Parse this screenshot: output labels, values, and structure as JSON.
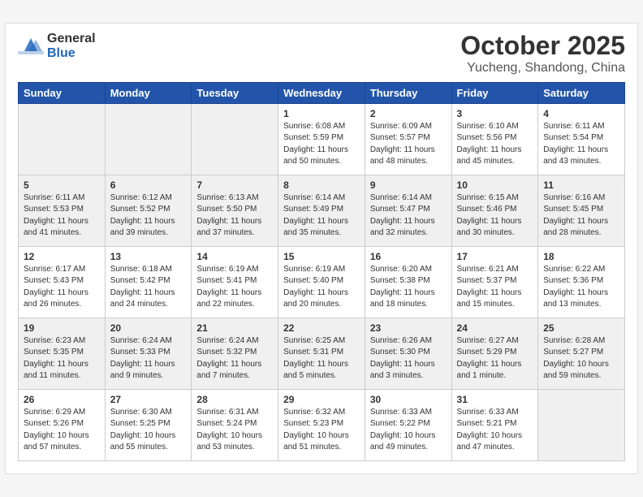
{
  "header": {
    "logo_general": "General",
    "logo_blue": "Blue",
    "month_title": "October 2025",
    "location": "Yucheng, Shandong, China"
  },
  "weekdays": [
    "Sunday",
    "Monday",
    "Tuesday",
    "Wednesday",
    "Thursday",
    "Friday",
    "Saturday"
  ],
  "weeks": [
    [
      {
        "day": "",
        "sunrise": "",
        "sunset": "",
        "daylight": "",
        "empty": true
      },
      {
        "day": "",
        "sunrise": "",
        "sunset": "",
        "daylight": "",
        "empty": true
      },
      {
        "day": "",
        "sunrise": "",
        "sunset": "",
        "daylight": "",
        "empty": true
      },
      {
        "day": "1",
        "sunrise": "Sunrise: 6:08 AM",
        "sunset": "Sunset: 5:59 PM",
        "daylight": "Daylight: 11 hours and 50 minutes.",
        "empty": false
      },
      {
        "day": "2",
        "sunrise": "Sunrise: 6:09 AM",
        "sunset": "Sunset: 5:57 PM",
        "daylight": "Daylight: 11 hours and 48 minutes.",
        "empty": false
      },
      {
        "day": "3",
        "sunrise": "Sunrise: 6:10 AM",
        "sunset": "Sunset: 5:56 PM",
        "daylight": "Daylight: 11 hours and 45 minutes.",
        "empty": false
      },
      {
        "day": "4",
        "sunrise": "Sunrise: 6:11 AM",
        "sunset": "Sunset: 5:54 PM",
        "daylight": "Daylight: 11 hours and 43 minutes.",
        "empty": false
      }
    ],
    [
      {
        "day": "5",
        "sunrise": "Sunrise: 6:11 AM",
        "sunset": "Sunset: 5:53 PM",
        "daylight": "Daylight: 11 hours and 41 minutes.",
        "empty": false
      },
      {
        "day": "6",
        "sunrise": "Sunrise: 6:12 AM",
        "sunset": "Sunset: 5:52 PM",
        "daylight": "Daylight: 11 hours and 39 minutes.",
        "empty": false
      },
      {
        "day": "7",
        "sunrise": "Sunrise: 6:13 AM",
        "sunset": "Sunset: 5:50 PM",
        "daylight": "Daylight: 11 hours and 37 minutes.",
        "empty": false
      },
      {
        "day": "8",
        "sunrise": "Sunrise: 6:14 AM",
        "sunset": "Sunset: 5:49 PM",
        "daylight": "Daylight: 11 hours and 35 minutes.",
        "empty": false
      },
      {
        "day": "9",
        "sunrise": "Sunrise: 6:14 AM",
        "sunset": "Sunset: 5:47 PM",
        "daylight": "Daylight: 11 hours and 32 minutes.",
        "empty": false
      },
      {
        "day": "10",
        "sunrise": "Sunrise: 6:15 AM",
        "sunset": "Sunset: 5:46 PM",
        "daylight": "Daylight: 11 hours and 30 minutes.",
        "empty": false
      },
      {
        "day": "11",
        "sunrise": "Sunrise: 6:16 AM",
        "sunset": "Sunset: 5:45 PM",
        "daylight": "Daylight: 11 hours and 28 minutes.",
        "empty": false
      }
    ],
    [
      {
        "day": "12",
        "sunrise": "Sunrise: 6:17 AM",
        "sunset": "Sunset: 5:43 PM",
        "daylight": "Daylight: 11 hours and 26 minutes.",
        "empty": false
      },
      {
        "day": "13",
        "sunrise": "Sunrise: 6:18 AM",
        "sunset": "Sunset: 5:42 PM",
        "daylight": "Daylight: 11 hours and 24 minutes.",
        "empty": false
      },
      {
        "day": "14",
        "sunrise": "Sunrise: 6:19 AM",
        "sunset": "Sunset: 5:41 PM",
        "daylight": "Daylight: 11 hours and 22 minutes.",
        "empty": false
      },
      {
        "day": "15",
        "sunrise": "Sunrise: 6:19 AM",
        "sunset": "Sunset: 5:40 PM",
        "daylight": "Daylight: 11 hours and 20 minutes.",
        "empty": false
      },
      {
        "day": "16",
        "sunrise": "Sunrise: 6:20 AM",
        "sunset": "Sunset: 5:38 PM",
        "daylight": "Daylight: 11 hours and 18 minutes.",
        "empty": false
      },
      {
        "day": "17",
        "sunrise": "Sunrise: 6:21 AM",
        "sunset": "Sunset: 5:37 PM",
        "daylight": "Daylight: 11 hours and 15 minutes.",
        "empty": false
      },
      {
        "day": "18",
        "sunrise": "Sunrise: 6:22 AM",
        "sunset": "Sunset: 5:36 PM",
        "daylight": "Daylight: 11 hours and 13 minutes.",
        "empty": false
      }
    ],
    [
      {
        "day": "19",
        "sunrise": "Sunrise: 6:23 AM",
        "sunset": "Sunset: 5:35 PM",
        "daylight": "Daylight: 11 hours and 11 minutes.",
        "empty": false
      },
      {
        "day": "20",
        "sunrise": "Sunrise: 6:24 AM",
        "sunset": "Sunset: 5:33 PM",
        "daylight": "Daylight: 11 hours and 9 minutes.",
        "empty": false
      },
      {
        "day": "21",
        "sunrise": "Sunrise: 6:24 AM",
        "sunset": "Sunset: 5:32 PM",
        "daylight": "Daylight: 11 hours and 7 minutes.",
        "empty": false
      },
      {
        "day": "22",
        "sunrise": "Sunrise: 6:25 AM",
        "sunset": "Sunset: 5:31 PM",
        "daylight": "Daylight: 11 hours and 5 minutes.",
        "empty": false
      },
      {
        "day": "23",
        "sunrise": "Sunrise: 6:26 AM",
        "sunset": "Sunset: 5:30 PM",
        "daylight": "Daylight: 11 hours and 3 minutes.",
        "empty": false
      },
      {
        "day": "24",
        "sunrise": "Sunrise: 6:27 AM",
        "sunset": "Sunset: 5:29 PM",
        "daylight": "Daylight: 11 hours and 1 minute.",
        "empty": false
      },
      {
        "day": "25",
        "sunrise": "Sunrise: 6:28 AM",
        "sunset": "Sunset: 5:27 PM",
        "daylight": "Daylight: 10 hours and 59 minutes.",
        "empty": false
      }
    ],
    [
      {
        "day": "26",
        "sunrise": "Sunrise: 6:29 AM",
        "sunset": "Sunset: 5:26 PM",
        "daylight": "Daylight: 10 hours and 57 minutes.",
        "empty": false
      },
      {
        "day": "27",
        "sunrise": "Sunrise: 6:30 AM",
        "sunset": "Sunset: 5:25 PM",
        "daylight": "Daylight: 10 hours and 55 minutes.",
        "empty": false
      },
      {
        "day": "28",
        "sunrise": "Sunrise: 6:31 AM",
        "sunset": "Sunset: 5:24 PM",
        "daylight": "Daylight: 10 hours and 53 minutes.",
        "empty": false
      },
      {
        "day": "29",
        "sunrise": "Sunrise: 6:32 AM",
        "sunset": "Sunset: 5:23 PM",
        "daylight": "Daylight: 10 hours and 51 minutes.",
        "empty": false
      },
      {
        "day": "30",
        "sunrise": "Sunrise: 6:33 AM",
        "sunset": "Sunset: 5:22 PM",
        "daylight": "Daylight: 10 hours and 49 minutes.",
        "empty": false
      },
      {
        "day": "31",
        "sunrise": "Sunrise: 6:33 AM",
        "sunset": "Sunset: 5:21 PM",
        "daylight": "Daylight: 10 hours and 47 minutes.",
        "empty": false
      },
      {
        "day": "",
        "sunrise": "",
        "sunset": "",
        "daylight": "",
        "empty": true
      }
    ]
  ]
}
